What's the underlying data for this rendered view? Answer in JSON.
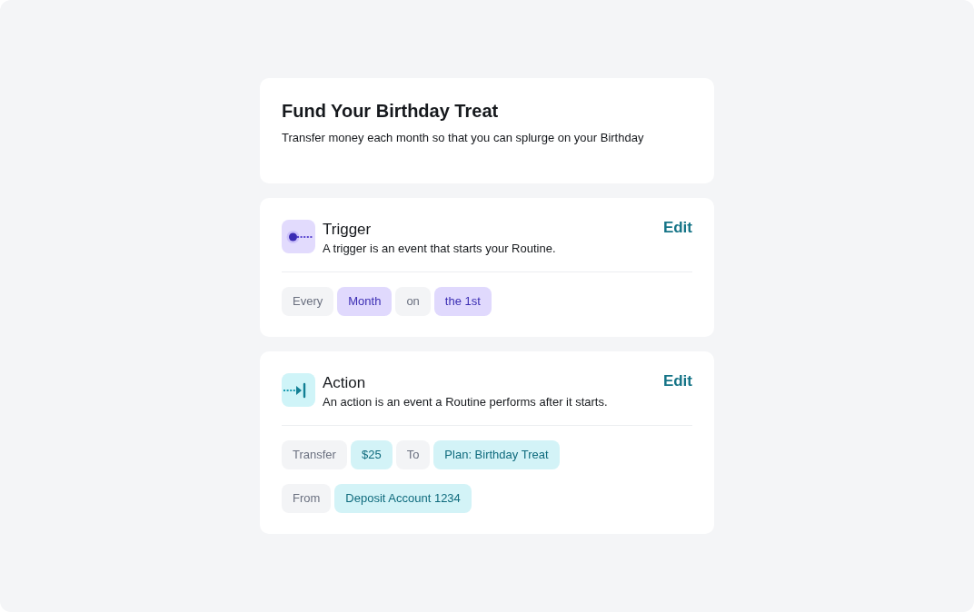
{
  "routine": {
    "title": "Fund Your Birthday Treat",
    "description": "Transfer money each month so that you can splurge on your Birthday"
  },
  "sections": [
    {
      "kind": "trigger",
      "title": "Trigger",
      "description": "A trigger is an event that starts your Routine.",
      "edit": "Edit",
      "rows": [
        {
          "chips": [
            {
              "kind": "word",
              "text": "Every"
            },
            {
              "kind": "choice",
              "text": "Month"
            },
            {
              "kind": "word",
              "text": "on"
            },
            {
              "kind": "choice",
              "text": "the 1st"
            }
          ]
        }
      ]
    },
    {
      "kind": "action",
      "title": "Action",
      "description": "An action is an event a Routine performs after it starts.",
      "edit": "Edit",
      "rows": [
        {
          "chips": [
            {
              "kind": "word",
              "text": "Transfer"
            },
            {
              "kind": "choice",
              "text": "$25"
            },
            {
              "kind": "word",
              "text": "To"
            },
            {
              "kind": "choice",
              "text": "Plan: Birthday Treat"
            }
          ]
        },
        {
          "chips": [
            {
              "kind": "word",
              "text": "From"
            },
            {
              "kind": "choice",
              "text": "Deposit Account 1234"
            }
          ]
        }
      ]
    }
  ]
}
